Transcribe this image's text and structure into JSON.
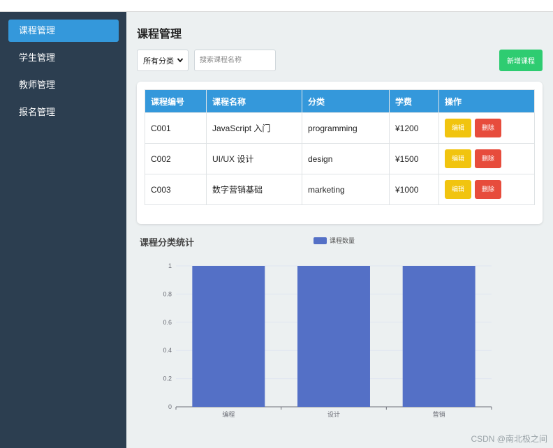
{
  "sidebar": {
    "items": [
      {
        "label": "课程管理",
        "active": true
      },
      {
        "label": "学生管理",
        "active": false
      },
      {
        "label": "教师管理",
        "active": false
      },
      {
        "label": "报名管理",
        "active": false
      }
    ]
  },
  "main": {
    "title": "课程管理",
    "filter_select": {
      "value": "所有分类",
      "icon": "chevron-down-icon"
    },
    "search": {
      "placeholder": "搜索课程名称",
      "value": ""
    },
    "add_button_label": "新增课程"
  },
  "table": {
    "headers": [
      "课程编号",
      "课程名称",
      "分类",
      "学费",
      "操作"
    ],
    "rows": [
      {
        "id": "C001",
        "name": "JavaScript 入门",
        "category": "programming",
        "fee": "¥1200",
        "edit_label": "编辑",
        "delete_label": "删除"
      },
      {
        "id": "C002",
        "name": "UI/UX 设计",
        "category": "design",
        "fee": "¥1500",
        "edit_label": "编辑",
        "delete_label": "删除"
      },
      {
        "id": "C003",
        "name": "数字营销基础",
        "category": "marketing",
        "fee": "¥1000",
        "edit_label": "编辑",
        "delete_label": "删除"
      }
    ]
  },
  "chart_section": {
    "title": "课程分类统计"
  },
  "chart_data": {
    "type": "bar",
    "categories": [
      "编程",
      "设计",
      "营销"
    ],
    "series": [
      {
        "name": "课程数量",
        "values": [
          1,
          1,
          1
        ],
        "color": "#5470c6"
      }
    ],
    "ylim": [
      0,
      1
    ],
    "yticks": [
      "0",
      "0.2",
      "0.4",
      "0.6",
      "0.8",
      "1"
    ],
    "grid": true,
    "legend": "top-center"
  },
  "colors": {
    "sidebar_bg": "#2c3e50",
    "accent": "#3498db",
    "success": "#2ecc71",
    "warning": "#f1c40f",
    "danger": "#e74c3c",
    "bar": "#5470c6"
  },
  "watermark": "CSDN @南北极之间"
}
